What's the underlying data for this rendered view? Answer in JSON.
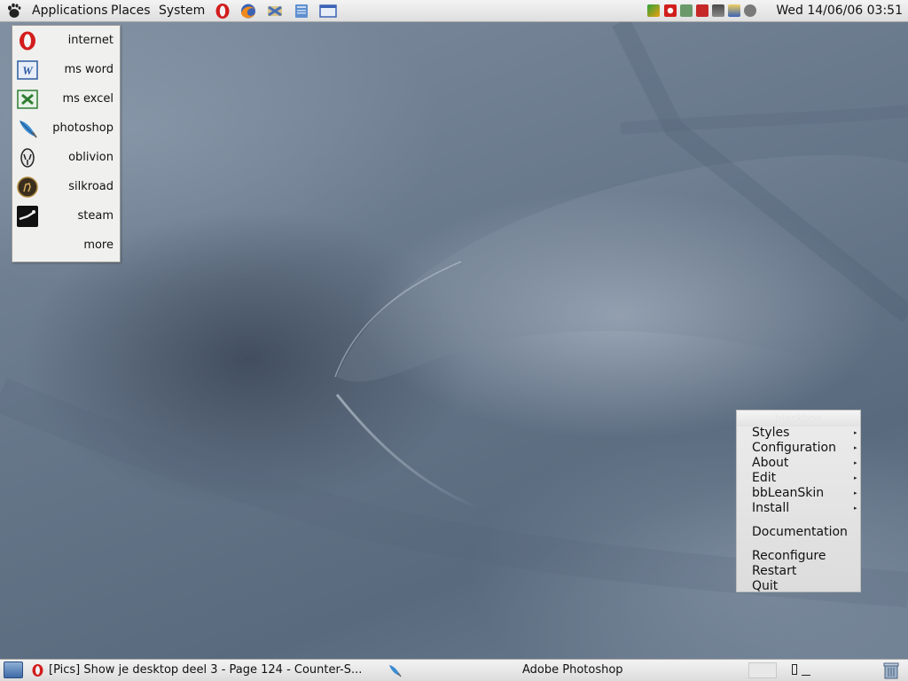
{
  "top_panel": {
    "menus": [
      "Applications",
      "Places",
      "System"
    ],
    "launchers": [
      "opera-icon",
      "firefox-icon",
      "thunderbird-icon",
      "notes-icon",
      "window-icon"
    ],
    "tray_icons": [
      "msn-icon",
      "opera-tray-icon",
      "network-icon",
      "shield-icon",
      "update-icon",
      "notes-tray-icon",
      "chat-icon",
      "sound-icon"
    ],
    "clock": "Wed 14/06/06  03:51"
  },
  "app_menu": {
    "items": [
      {
        "label": "internet",
        "icon": "opera-icon"
      },
      {
        "label": "ms word",
        "icon": "word-icon"
      },
      {
        "label": "ms excel",
        "icon": "excel-icon"
      },
      {
        "label": "photoshop",
        "icon": "photoshop-feather-icon"
      },
      {
        "label": "oblivion",
        "icon": "oblivion-icon"
      },
      {
        "label": "silkroad",
        "icon": "silkroad-icon"
      },
      {
        "label": "steam",
        "icon": "steam-icon"
      },
      {
        "label": "more",
        "icon": ""
      }
    ]
  },
  "bb_menu": {
    "title": "blackbox",
    "items": [
      {
        "label": "Styles",
        "submenu": true
      },
      {
        "label": "Configuration",
        "submenu": true
      },
      {
        "label": "About",
        "submenu": true
      },
      {
        "label": "Edit",
        "submenu": true
      },
      {
        "label": "bbLeanSkin",
        "submenu": true
      },
      {
        "label": "Install",
        "submenu": true
      },
      {
        "label": "Documentation",
        "submenu": false
      },
      {
        "label": "Reconfigure",
        "submenu": false
      },
      {
        "label": "Restart",
        "submenu": false
      },
      {
        "label": "Quit",
        "submenu": false
      }
    ]
  },
  "taskbar": {
    "tasks": [
      {
        "label": "[Pics] Show je desktop deel 3 - Page 124 - Counter-S...",
        "icon": "opera-icon"
      },
      {
        "label": "Adobe Photoshop",
        "icon": "photoshop-feather-icon"
      }
    ]
  },
  "colors": {
    "panel": "#e6e6e6",
    "desktop": "#65758a",
    "menu_bg": "#f0f0ee"
  }
}
